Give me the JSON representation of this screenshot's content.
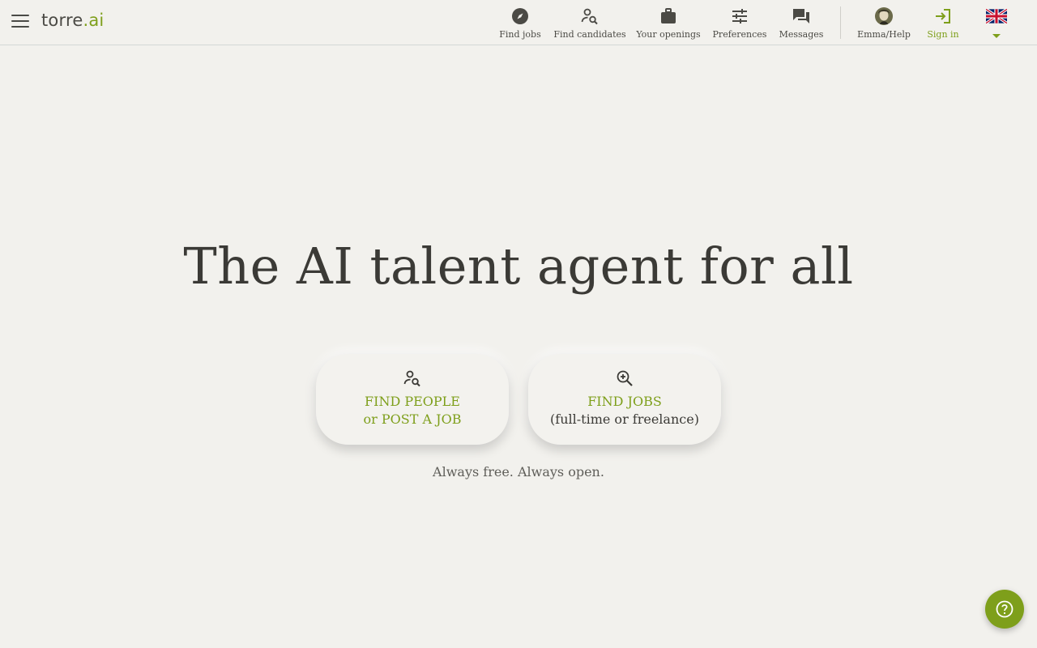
{
  "brand": {
    "logo_main": "torre",
    "logo_dot": ".",
    "logo_suffix": "ai"
  },
  "nav": {
    "find_jobs": "Find jobs",
    "find_candidates": "Find candidates",
    "your_openings": "Your openings",
    "preferences": "Preferences",
    "messages": "Messages",
    "emma_help": "Emma/Help",
    "sign_in": "Sign in"
  },
  "icons": {
    "menu": "hamburger-menu-icon",
    "find_jobs": "compass-icon",
    "find_candidates": "person-search-icon",
    "your_openings": "briefcase-icon",
    "preferences": "sliders-icon",
    "messages": "chat-bubbles-icon",
    "emma": "avatar-portrait",
    "sign_in": "login-arrow-icon",
    "language": "uk-flag-icon",
    "help": "question-circle-icon"
  },
  "hero": {
    "title": "The AI talent agent for all"
  },
  "cta": {
    "people": {
      "line1": "FIND PEOPLE",
      "line2": "or POST A JOB"
    },
    "jobs": {
      "line1": "FIND JOBS",
      "line2": "(full-time or freelance)"
    }
  },
  "tagline": "Always free. Always open.",
  "colors": {
    "accent": "#7e9f1b",
    "background": "#f2f1ed",
    "text": "#3b3a36"
  }
}
